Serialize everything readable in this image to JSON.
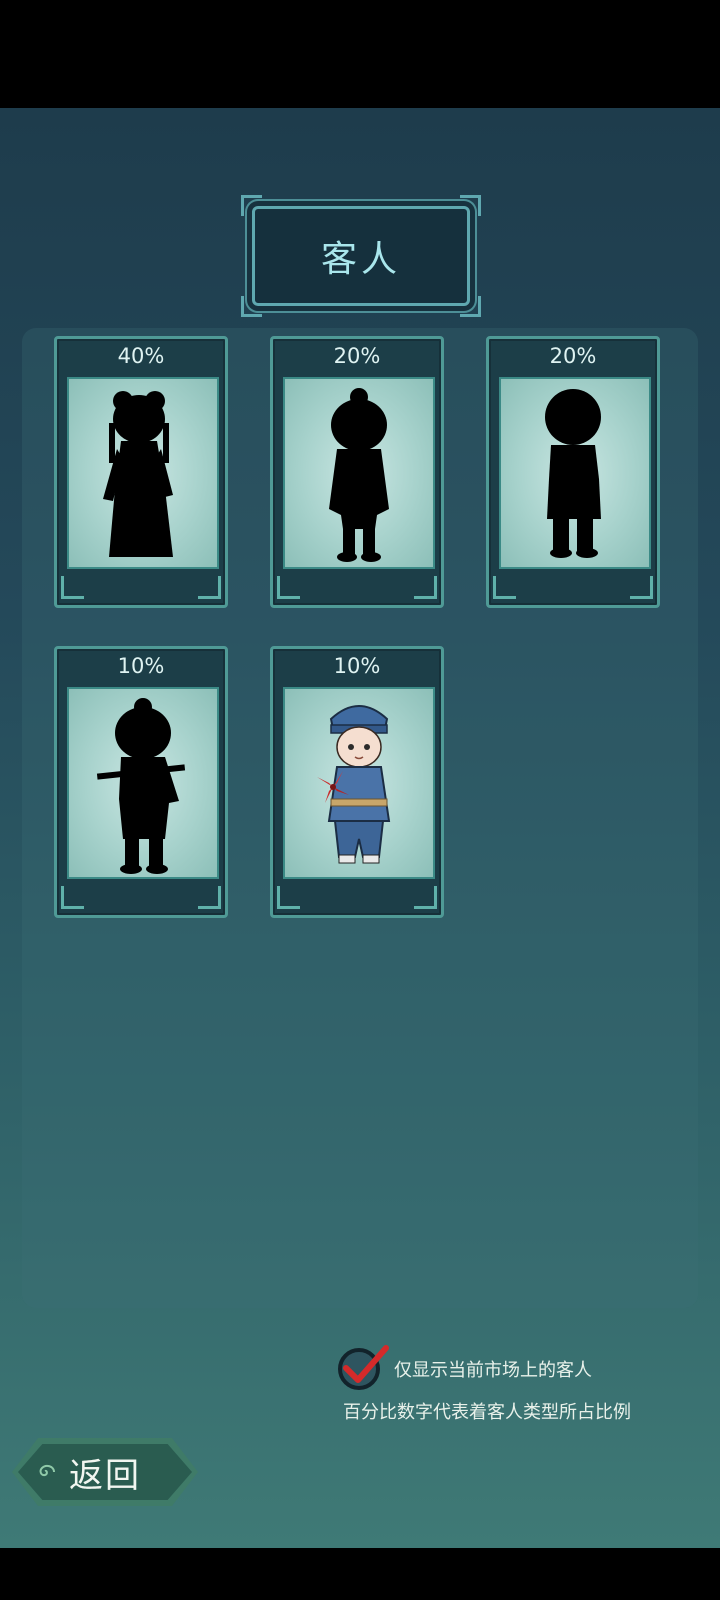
{
  "header": {
    "title": "客人"
  },
  "customers": [
    {
      "percent": "40%",
      "revealed": false,
      "figure": "lady-silhouette"
    },
    {
      "percent": "20%",
      "revealed": false,
      "figure": "scholar-silhouette"
    },
    {
      "percent": "20%",
      "revealed": false,
      "figure": "child-silhouette"
    },
    {
      "percent": "10%",
      "revealed": false,
      "figure": "flute-boy-silhouette"
    },
    {
      "percent": "10%",
      "revealed": true,
      "figure": "boy-with-pinwheel"
    }
  ],
  "filter": {
    "checked": true,
    "label": "仅显示当前市场上的客人"
  },
  "hint": "百分比数字代表着客人类型所占比例",
  "footer": {
    "back_label": "返回"
  },
  "colors": {
    "panel_bg": "#24495a",
    "card_border": "#4f9a96",
    "title_text": "#a9e6ec",
    "check_mark": "#d42a2a"
  }
}
